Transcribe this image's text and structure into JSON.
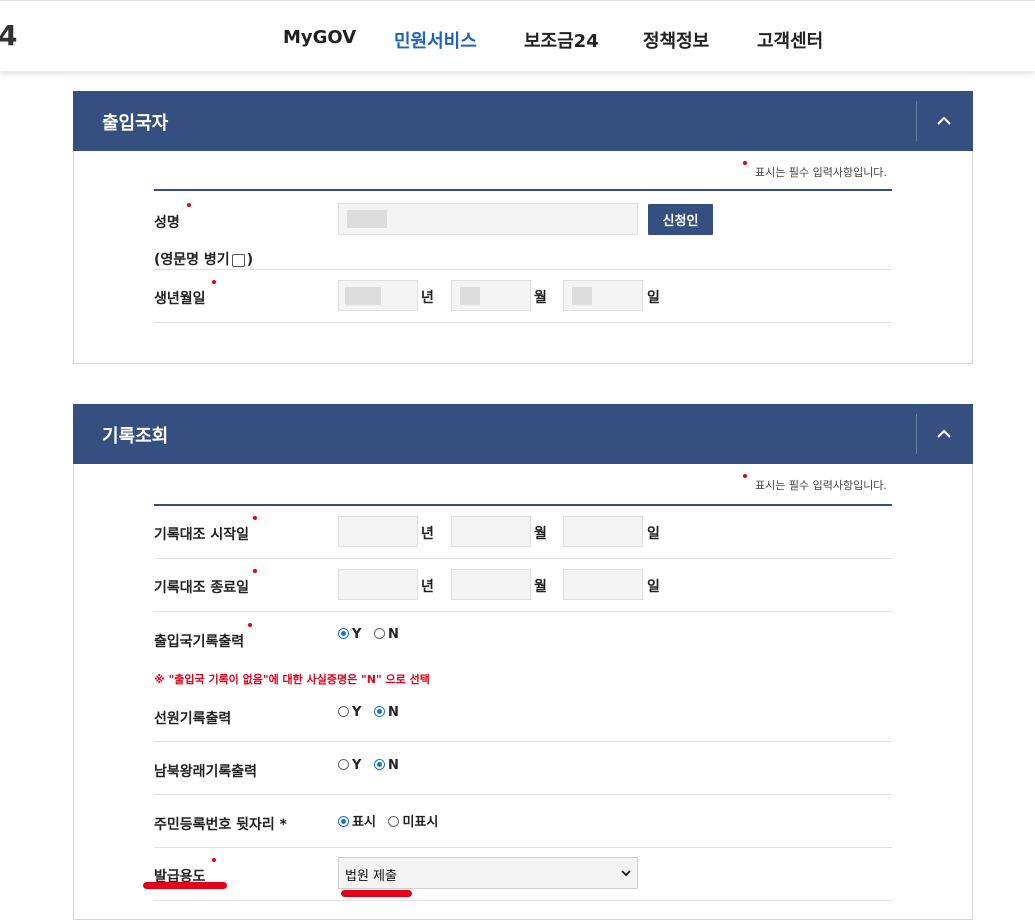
{
  "header": {
    "logo_fragment": "4",
    "nav": [
      {
        "label": "MyGOV",
        "active": false
      },
      {
        "label": "민원서비스",
        "active": true
      },
      {
        "label": "보조금24",
        "active": false
      },
      {
        "label": "정책정보",
        "active": false
      },
      {
        "label": "고객센터",
        "active": false
      }
    ]
  },
  "section1": {
    "title": "출입국자",
    "required_note": "표시는 필수 입력사항입니다.",
    "name_label": "성명",
    "applicant_button": "신청인",
    "english_name_label": "(영문명 병기",
    "english_name_close": ")",
    "birth_label": "생년월일",
    "unit_year": "년",
    "unit_month": "월",
    "unit_day": "일"
  },
  "section2": {
    "title": "기록조회",
    "required_note": "표시는 필수 입력사항입니다.",
    "start_label": "기록대조 시작일",
    "end_label": "기록대조 종료일",
    "unit_year": "년",
    "unit_month": "월",
    "unit_day": "일",
    "immigration_label": "출입국기록출력",
    "warning": "※ \"출입국 기록이 없음\"에 대한 사실증명은 \"N\" 으로 선택",
    "seaman_label": "선원기록출력",
    "intra_korea_label": "남북왕래기록출력",
    "resident_label": "주민등록번호 뒷자리 *",
    "purpose_label": "발급용도",
    "purpose_value": "법원 제출",
    "opt_y": "Y",
    "opt_n": "N",
    "opt_show": "표시",
    "opt_hide": "미표시",
    "selections": {
      "immigration": "Y",
      "seaman": "N",
      "intra_korea": "N",
      "resident": "표시"
    }
  },
  "colors": {
    "panel_header": "#355080",
    "nav_active": "#1b62c4",
    "required_dot": "#e5001a",
    "annotation": "#e5001a"
  }
}
